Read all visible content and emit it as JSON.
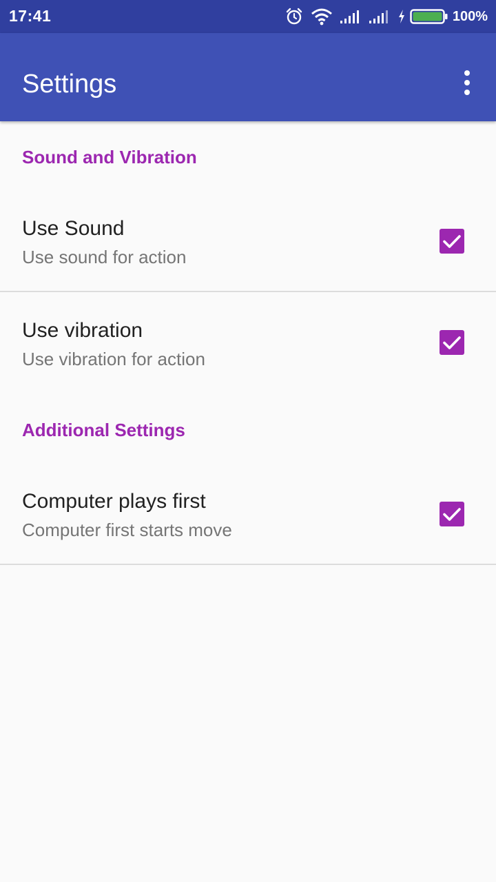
{
  "status_bar": {
    "time": "17:41",
    "battery_percent": "100%",
    "icons": [
      "alarm-icon",
      "wifi-icon",
      "signal-icon",
      "signal-icon",
      "charging-icon",
      "battery-icon"
    ]
  },
  "app_bar": {
    "title": "Settings",
    "menu_icon": "more-vert-icon"
  },
  "colors": {
    "status_bar": "#303f9f",
    "app_bar": "#3f51b5",
    "accent": "#9c27b0",
    "battery_fill": "#4caf50"
  },
  "sections": [
    {
      "header": "Sound and Vibration",
      "items": [
        {
          "title": "Use Sound",
          "summary": "Use sound for action",
          "checked": true
        },
        {
          "title": "Use vibration",
          "summary": "Use vibration for action",
          "checked": true
        }
      ]
    },
    {
      "header": "Additional Settings",
      "items": [
        {
          "title": "Computer plays first",
          "summary": "Computer first starts move",
          "checked": true
        }
      ]
    }
  ]
}
